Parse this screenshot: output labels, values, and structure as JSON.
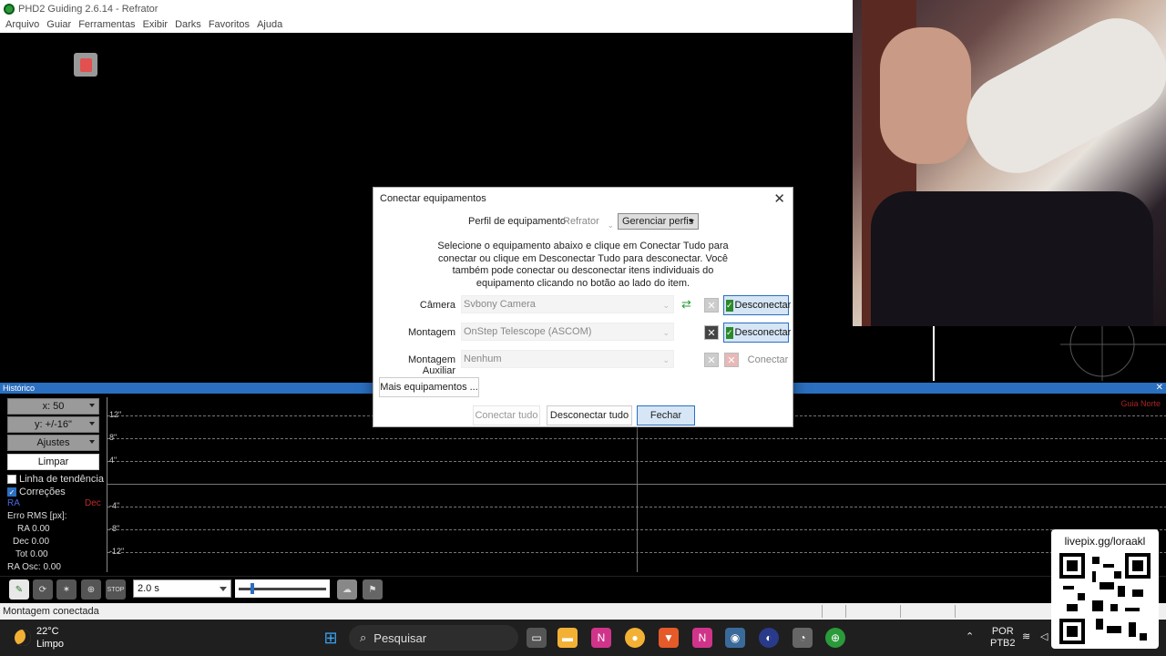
{
  "window": {
    "title": "PHD2 Guiding 2.6.14 - Refrator",
    "menu": [
      "Arquivo",
      "Guiar",
      "Ferramentas",
      "Exibir",
      "Darks",
      "Favoritos",
      "Ajuda"
    ]
  },
  "dialog": {
    "title": "Conectar equipamentos",
    "profile_label": "Perfil de equipamento",
    "profile_value": "Refrator",
    "manage_profiles": "Gerenciar perfis",
    "description": "Selecione o equipamento abaixo e clique em Conectar Tudo para conectar ou clique em Desconectar Tudo para desconectar. Você também pode conectar ou desconectar itens individuais do equipamento clicando no botão ao lado do item.",
    "rows": [
      {
        "label": "Câmera",
        "value": "Svbony Camera",
        "button": "Desconectar"
      },
      {
        "label": "Montagem",
        "value": "OnStep Telescope (ASCOM)",
        "button": "Desconectar"
      },
      {
        "label": "Montagem Auxiliar",
        "value": "Nenhum",
        "button": "Conectar"
      }
    ],
    "more_equipment": "Mais equipamentos ...",
    "connect_all": "Conectar tudo",
    "disconnect_all": "Desconectar tudo",
    "close": "Fechar"
  },
  "history": {
    "title": "Histórico",
    "x_scale": "x: 50",
    "y_scale": "y: +/-16\"",
    "settings": "Ajustes",
    "clear": "Limpar",
    "trend_line": "Linha de tendência",
    "corrections": "Correções",
    "ra_label": "RA",
    "dec_label": "Dec",
    "rms_label": "Erro RMS [px]:",
    "rms_ra": "RA 0.00",
    "rms_dec": "Dec 0.00",
    "rms_tot": "Tot 0.00",
    "ra_osc": "RA Osc: 0.00",
    "guide_note": "Guia Norte",
    "y_ticks": [
      "12\"",
      "8\"",
      "4\"",
      "-4\"",
      "-8\"",
      "-12\""
    ]
  },
  "toolbar": {
    "exposure": "2.0 s"
  },
  "status": "Montagem conectada",
  "overlay": {
    "livepix": "livepix.gg/loraakl"
  },
  "taskbar": {
    "temperature": "22°C",
    "weather": "Limpo",
    "search": "Pesquisar",
    "lang1": "POR",
    "lang2": "PTB2"
  },
  "colors": {
    "accent": "#2b6fc0",
    "ra": "#4a6ae0",
    "dec": "#c02a2a"
  }
}
